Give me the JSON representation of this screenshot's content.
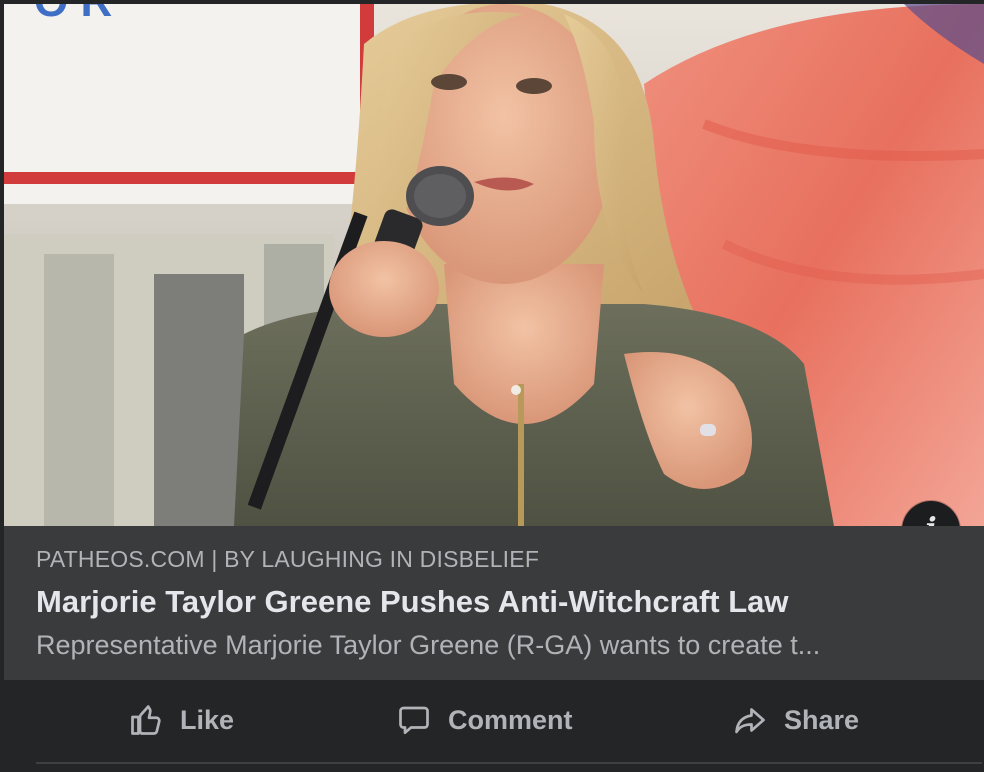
{
  "link_preview": {
    "source": "PATHEOS.COM | BY LAUGHING IN DISBELIEF",
    "headline": "Marjorie Taylor Greene Pushes Anti-Witchcraft Law",
    "description": "Representative Marjorie Taylor Greene (R-GA) wants to create t...",
    "info_glyph": "i"
  },
  "actions": {
    "like": "Like",
    "comment": "Comment",
    "share": "Share"
  },
  "icons": {
    "like": "thumbs-up-icon",
    "comment": "speech-bubble-icon",
    "share": "share-arrow-icon",
    "info": "info-icon"
  },
  "colors": {
    "card_background": "#242526",
    "caption_background": "#3a3b3c",
    "primary_text": "#e4e6eb",
    "secondary_text": "#b0b3b8"
  }
}
